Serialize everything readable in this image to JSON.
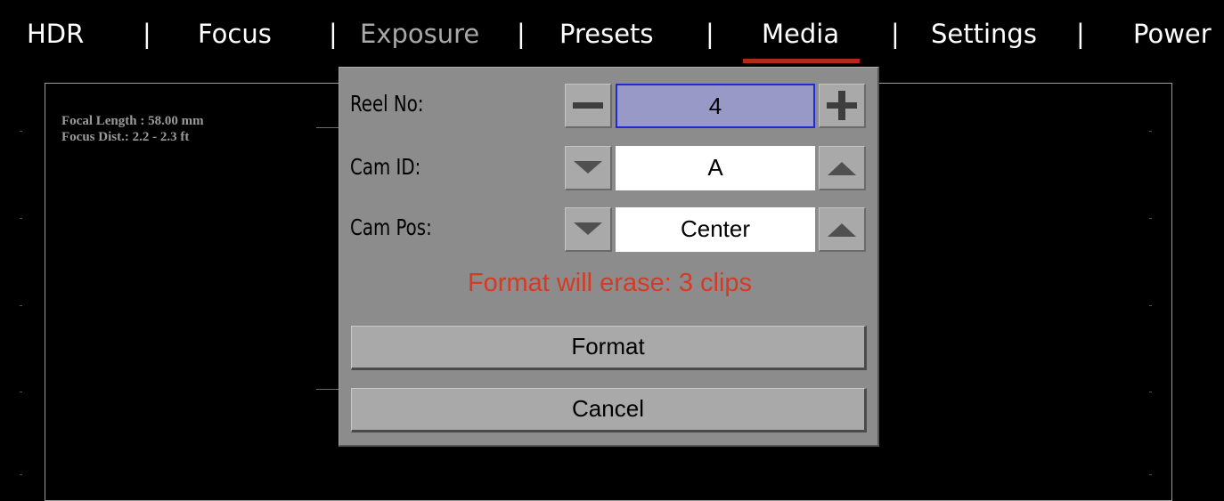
{
  "menu": {
    "items": [
      {
        "label": "HDR"
      },
      {
        "label": "Focus"
      },
      {
        "label": "Exposure"
      },
      {
        "label": "Presets"
      },
      {
        "label": "Media"
      },
      {
        "label": "Settings"
      },
      {
        "label": "Power"
      }
    ],
    "separator": "|",
    "active": "Media",
    "active_color": "#b5281f"
  },
  "overlay": {
    "focal_length": "Focal Length : 58.00 mm",
    "focus_distance": "Focus Dist.: 2.2 - 2.3 ft"
  },
  "dialog": {
    "reel": {
      "label": "Reel No:",
      "value": "4",
      "decrement": "minus-icon",
      "increment": "plus-icon"
    },
    "cam_id": {
      "label": "Cam ID:",
      "value": "A",
      "decrement": "triangle-down-icon",
      "increment": "triangle-up-icon"
    },
    "cam_pos": {
      "label": "Cam Pos:",
      "value": "Center",
      "decrement": "triangle-down-icon",
      "increment": "triangle-up-icon"
    },
    "warning": "Format will erase: 3 clips",
    "warning_color": "#d63a24",
    "format_label": "Format",
    "cancel_label": "Cancel",
    "selected_color": "#9999c8",
    "selected_border": "#1d2bd0"
  }
}
